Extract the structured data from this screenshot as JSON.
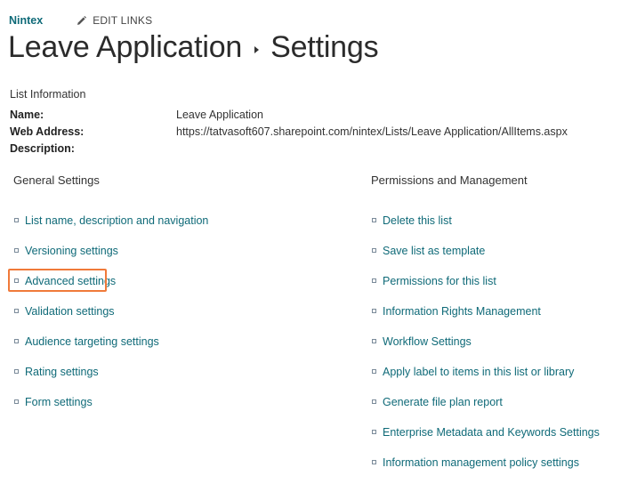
{
  "header": {
    "site_name": "Nintex",
    "edit_links": "EDIT LINKS"
  },
  "title": {
    "list_name": "Leave Application",
    "page": "Settings"
  },
  "list_information": {
    "heading": "List Information",
    "rows": [
      {
        "label": "Name:",
        "value": "Leave Application"
      },
      {
        "label": "Web Address:",
        "value": "https://tatvasoft607.sharepoint.com/nintex/Lists/Leave Application/AllItems.aspx"
      },
      {
        "label": "Description:",
        "value": ""
      }
    ]
  },
  "general_settings": {
    "heading": "General Settings",
    "items": [
      "List name, description and navigation",
      "Versioning settings",
      "Advanced settings",
      "Validation settings",
      "Audience targeting settings",
      "Rating settings",
      "Form settings"
    ]
  },
  "permissions_management": {
    "heading": "Permissions and Management",
    "items": [
      "Delete this list",
      "Save list as template",
      "Permissions for this list",
      "Information Rights Management",
      "Workflow Settings",
      "Apply label to items in this list or library",
      "Generate file plan report",
      "Enterprise Metadata and Keywords Settings",
      "Information management policy settings"
    ]
  },
  "colors": {
    "link": "#0f6a78",
    "highlight": "#f07a3a",
    "title": "#2b2b2b"
  }
}
